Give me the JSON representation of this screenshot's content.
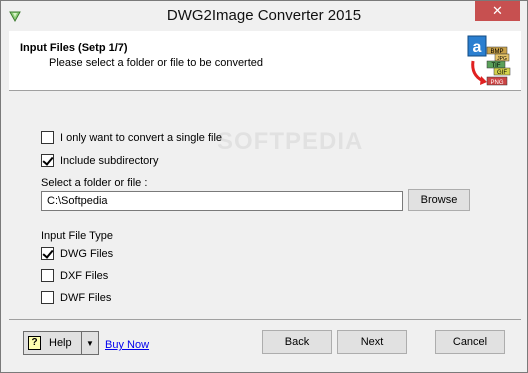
{
  "window": {
    "title": "DWG2Image Converter 2015",
    "close_glyph": "✕"
  },
  "header": {
    "title": "Input Files (Setp 1/7)",
    "subtitle": "Please select a folder or file to be converted",
    "logo_tags": [
      "BMP",
      "JPG",
      "TIF",
      "GIF",
      "PNG"
    ],
    "logo_letter": "a"
  },
  "watermark": "SOFTPEDIA",
  "options": {
    "single_file": {
      "label": "I only want to convert a single file",
      "checked": false
    },
    "include_sub": {
      "label": "Include subdirectory",
      "checked": true
    }
  },
  "folder": {
    "label": "Select a folder or file :",
    "value": "C:\\Softpedia",
    "browse_label": "Browse"
  },
  "file_types": {
    "label": "Input File Type",
    "items": [
      {
        "label": "DWG Files",
        "checked": true
      },
      {
        "label": "DXF Files",
        "checked": false
      },
      {
        "label": "DWF Files",
        "checked": false
      }
    ]
  },
  "footer": {
    "help_label": "Help",
    "help_icon_glyph": "?",
    "help_dropdown_glyph": "▼",
    "buy_label": "Buy Now",
    "back_label": "Back",
    "next_label": "Next",
    "cancel_label": "Cancel"
  }
}
